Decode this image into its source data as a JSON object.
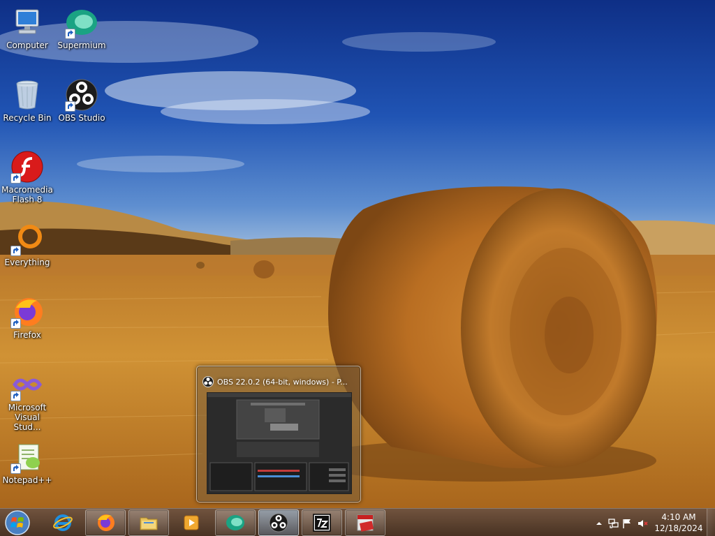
{
  "desktop": {
    "icons": [
      {
        "label": "Computer",
        "icon": "computer-icon",
        "shortcut": false
      },
      {
        "label": "Supermium",
        "icon": "supermium-icon",
        "shortcut": true
      },
      {
        "label": "Recycle Bin",
        "icon": "recycle-bin-icon",
        "shortcut": false
      },
      {
        "label": "OBS Studio",
        "icon": "obs-icon",
        "shortcut": true
      },
      {
        "label": "Macromedia Flash 8",
        "icon": "flash-icon",
        "shortcut": true
      },
      {
        "label": "Everything",
        "icon": "everything-icon",
        "shortcut": true
      },
      {
        "label": "Firefox",
        "icon": "firefox-icon",
        "shortcut": true
      },
      {
        "label": "Microsoft Visual Stud...",
        "icon": "visual-studio-icon",
        "shortcut": true
      },
      {
        "label": "Notepad++",
        "icon": "notepadpp-icon",
        "shortcut": true
      }
    ]
  },
  "preview": {
    "title": "OBS 22.0.2 (64-bit, windows) - P..."
  },
  "taskbar": {
    "buttons": [
      {
        "name": "start-button",
        "icon": "windows-orb-icon"
      },
      {
        "name": "internet-explorer",
        "icon": "ie-icon",
        "running": false
      },
      {
        "name": "firefox",
        "icon": "firefox-icon",
        "running": true
      },
      {
        "name": "windows-explorer",
        "icon": "folder-icon",
        "running": true
      },
      {
        "name": "media-player",
        "icon": "media-player-icon",
        "running": false
      },
      {
        "name": "supermium",
        "icon": "supermium-icon",
        "running": true
      },
      {
        "name": "obs-studio",
        "icon": "obs-icon",
        "running": true,
        "active": true
      },
      {
        "name": "7-zip",
        "icon": "7zip-icon",
        "running": true
      },
      {
        "name": "pdf-app",
        "icon": "pdf-icon",
        "running": true
      }
    ],
    "tray": {
      "time": "4:10 AM",
      "date": "12/18/2024",
      "icons": [
        "show-hidden-icon",
        "network-icon",
        "action-center-flag-icon",
        "volume-muted-icon"
      ]
    }
  },
  "colors": {
    "sky": "#1a3f8f",
    "field": "#c88a2c",
    "taskbar": "#5a3c22"
  }
}
